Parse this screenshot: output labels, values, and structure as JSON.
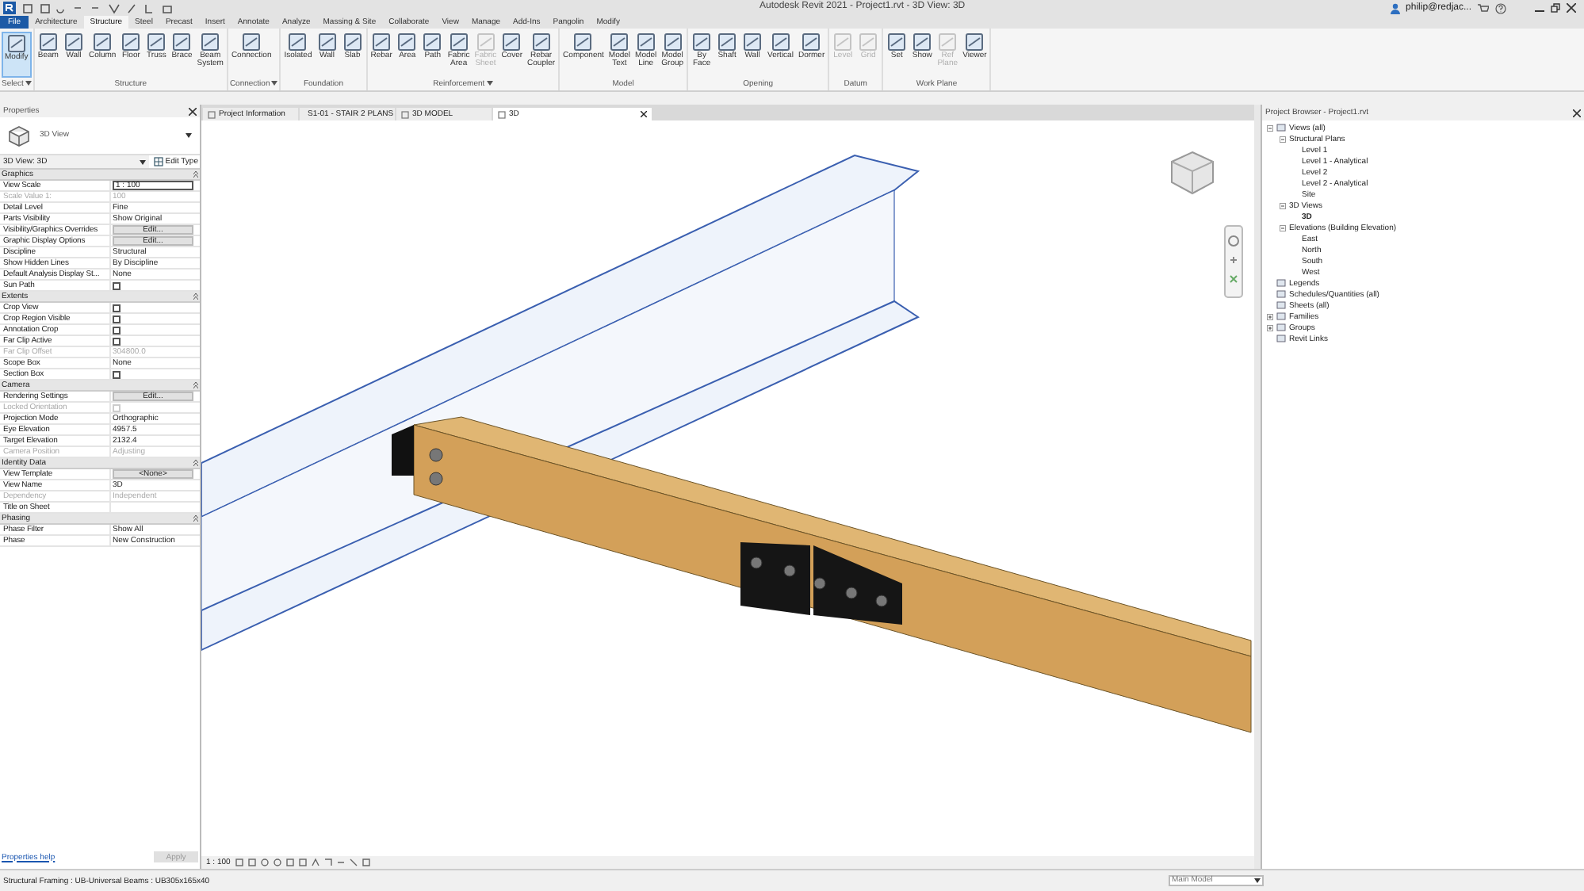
{
  "window": {
    "title": "Autodesk Revit 2021 - Project1.rvt - 3D View: 3D",
    "user": "philip@redjac..."
  },
  "menu_tabs": [
    {
      "label": "File",
      "kind": "application",
      "selected": false
    },
    {
      "label": "Architecture",
      "kind": "tab",
      "selected": false
    },
    {
      "label": "Structure",
      "kind": "tab",
      "selected": true
    },
    {
      "label": "Steel",
      "kind": "tab",
      "selected": false
    },
    {
      "label": "Precast",
      "kind": "tab",
      "selected": false
    },
    {
      "label": "Insert",
      "kind": "tab",
      "selected": false
    },
    {
      "label": "Annotate",
      "kind": "tab",
      "selected": false
    },
    {
      "label": "Analyze",
      "kind": "tab",
      "selected": false
    },
    {
      "label": "Massing & Site",
      "kind": "tab",
      "selected": false
    },
    {
      "label": "Collaborate",
      "kind": "tab",
      "selected": false
    },
    {
      "label": "View",
      "kind": "tab",
      "selected": false
    },
    {
      "label": "Manage",
      "kind": "tab",
      "selected": false
    },
    {
      "label": "Add-Ins",
      "kind": "tab",
      "selected": false
    },
    {
      "label": "Pangolin",
      "kind": "tab",
      "selected": false
    },
    {
      "label": "Modify",
      "kind": "tab",
      "selected": false
    }
  ],
  "ribbon_panels": [
    {
      "title": "Select",
      "dropdown": true,
      "tools": [
        {
          "label": "Modify",
          "selected": true,
          "disabled": false
        }
      ]
    },
    {
      "title": "Structure",
      "dropdown": false,
      "tools": [
        {
          "label": "Beam",
          "selected": false,
          "disabled": false
        },
        {
          "label": "Wall",
          "selected": false,
          "disabled": false
        },
        {
          "label": "Column",
          "selected": false,
          "disabled": false
        },
        {
          "label": "Floor",
          "selected": false,
          "disabled": false
        },
        {
          "label": "Truss",
          "selected": false,
          "disabled": false
        },
        {
          "label": "Brace",
          "selected": false,
          "disabled": false
        },
        {
          "label": "Beam System",
          "selected": false,
          "disabled": false
        }
      ]
    },
    {
      "title": "Connection",
      "dropdown": true,
      "tools": [
        {
          "label": "Connection",
          "selected": false,
          "disabled": false
        }
      ]
    },
    {
      "title": "Foundation",
      "dropdown": false,
      "tools": [
        {
          "label": "Isolated",
          "selected": false,
          "disabled": false
        },
        {
          "label": "Wall",
          "selected": false,
          "disabled": false
        },
        {
          "label": "Slab",
          "selected": false,
          "disabled": false
        }
      ]
    },
    {
      "title": "Reinforcement",
      "dropdown": true,
      "tools": [
        {
          "label": "Rebar",
          "selected": false,
          "disabled": false
        },
        {
          "label": "Area",
          "selected": false,
          "disabled": false
        },
        {
          "label": "Path",
          "selected": false,
          "disabled": false
        },
        {
          "label": "Fabric Area",
          "selected": false,
          "disabled": false
        },
        {
          "label": "Fabric Sheet",
          "selected": false,
          "disabled": true
        },
        {
          "label": "Cover",
          "selected": false,
          "disabled": false
        },
        {
          "label": "Rebar Coupler",
          "selected": false,
          "disabled": false
        }
      ]
    },
    {
      "title": "Model",
      "dropdown": false,
      "tools": [
        {
          "label": "Component",
          "selected": false,
          "disabled": false
        },
        {
          "label": "Model Text",
          "selected": false,
          "disabled": false
        },
        {
          "label": "Model Line",
          "selected": false,
          "disabled": false
        },
        {
          "label": "Model Group",
          "selected": false,
          "disabled": false
        }
      ]
    },
    {
      "title": "Opening",
      "dropdown": false,
      "tools": [
        {
          "label": "By Face",
          "selected": false,
          "disabled": false
        },
        {
          "label": "Shaft",
          "selected": false,
          "disabled": false
        },
        {
          "label": "Wall",
          "selected": false,
          "disabled": false
        },
        {
          "label": "Vertical",
          "selected": false,
          "disabled": false
        },
        {
          "label": "Dormer",
          "selected": false,
          "disabled": false
        }
      ]
    },
    {
      "title": "Datum",
      "dropdown": false,
      "tools": [
        {
          "label": "Level",
          "selected": false,
          "disabled": true
        },
        {
          "label": "Grid",
          "selected": false,
          "disabled": true
        }
      ]
    },
    {
      "title": "Work Plane",
      "dropdown": false,
      "tools": [
        {
          "label": "Set",
          "selected": false,
          "disabled": false
        },
        {
          "label": "Show",
          "selected": false,
          "disabled": false
        },
        {
          "label": "Ref Plane",
          "selected": false,
          "disabled": true
        },
        {
          "label": "Viewer",
          "selected": false,
          "disabled": false
        }
      ]
    }
  ],
  "properties": {
    "title": "Properties",
    "type_name": "3D View",
    "type_selector": "3D View: 3D",
    "edit_type": "Edit Type",
    "groups": [
      {
        "name": "Graphics",
        "rows": [
          {
            "label": "View Scale",
            "value": "1 : 100",
            "kind": "field",
            "disabled": false
          },
          {
            "label": "Scale Value    1:",
            "value": "100",
            "kind": "text",
            "disabled": true
          },
          {
            "label": "Detail Level",
            "value": "Fine",
            "kind": "text",
            "disabled": false
          },
          {
            "label": "Parts Visibility",
            "value": "Show Original",
            "kind": "text",
            "disabled": false
          },
          {
            "label": "Visibility/Graphics Overrides",
            "value": "Edit...",
            "kind": "button",
            "disabled": false
          },
          {
            "label": "Graphic Display Options",
            "value": "Edit...",
            "kind": "button",
            "disabled": false
          },
          {
            "label": "Discipline",
            "value": "Structural",
            "kind": "text",
            "disabled": false
          },
          {
            "label": "Show Hidden Lines",
            "value": "By Discipline",
            "kind": "text",
            "disabled": false
          },
          {
            "label": "Default Analysis Display St...",
            "value": "None",
            "kind": "text",
            "disabled": false
          },
          {
            "label": "Sun Path",
            "kind": "checkbox",
            "checked": false,
            "disabled": false
          }
        ]
      },
      {
        "name": "Extents",
        "rows": [
          {
            "label": "Crop View",
            "kind": "checkbox",
            "checked": false,
            "disabled": false
          },
          {
            "label": "Crop Region Visible",
            "kind": "checkbox",
            "checked": false,
            "disabled": false
          },
          {
            "label": "Annotation Crop",
            "kind": "checkbox",
            "checked": false,
            "disabled": false
          },
          {
            "label": "Far Clip Active",
            "kind": "checkbox",
            "checked": false,
            "disabled": false
          },
          {
            "label": "Far Clip Offset",
            "value": "304800.0",
            "kind": "text",
            "disabled": true
          },
          {
            "label": "Scope Box",
            "value": "None",
            "kind": "text",
            "disabled": false
          },
          {
            "label": "Section Box",
            "kind": "checkbox",
            "checked": false,
            "disabled": false
          }
        ]
      },
      {
        "name": "Camera",
        "rows": [
          {
            "label": "Rendering Settings",
            "value": "Edit...",
            "kind": "button",
            "disabled": false
          },
          {
            "label": "Locked Orientation",
            "kind": "checkbox",
            "checked": false,
            "disabled": true
          },
          {
            "label": "Projection Mode",
            "value": "Orthographic",
            "kind": "text",
            "disabled": false
          },
          {
            "label": "Eye Elevation",
            "value": "4957.5",
            "kind": "text",
            "disabled": false
          },
          {
            "label": "Target Elevation",
            "value": "2132.4",
            "kind": "text",
            "disabled": false
          },
          {
            "label": "Camera Position",
            "value": "Adjusting",
            "kind": "text",
            "disabled": true
          }
        ]
      },
      {
        "name": "Identity Data",
        "rows": [
          {
            "label": "View Template",
            "value": "<None>",
            "kind": "button",
            "disabled": false
          },
          {
            "label": "View Name",
            "value": "3D",
            "kind": "text",
            "disabled": false
          },
          {
            "label": "Dependency",
            "value": "Independent",
            "kind": "text",
            "disabled": true
          },
          {
            "label": "Title on Sheet",
            "kind": "text",
            "disabled": false
          }
        ]
      },
      {
        "name": "Phasing",
        "rows": [
          {
            "label": "Phase Filter",
            "value": "Show All",
            "kind": "text",
            "disabled": false
          },
          {
            "label": "Phase",
            "value": "New Construction",
            "kind": "text",
            "disabled": false
          }
        ]
      }
    ],
    "help_link": "Properties help",
    "apply": "Apply"
  },
  "view_tabs": [
    {
      "label": "Project Information",
      "selected": false
    },
    {
      "label": "S1-01 - STAIR 2 PLANS",
      "selected": false
    },
    {
      "label": "3D MODEL",
      "selected": false
    },
    {
      "label": "3D",
      "selected": true
    }
  ],
  "view_control_bar": {
    "scale": "1 : 100"
  },
  "project_browser": {
    "title": "Project Browser - Project1.rvt",
    "tree": [
      {
        "label": "Views (all)",
        "expanded": true,
        "bold": false,
        "children": [
          {
            "label": "Structural Plans",
            "expanded": true,
            "bold": false,
            "children": [
              {
                "label": "Level 1",
                "bold": false
              },
              {
                "label": "Level 1 - Analytical",
                "bold": false
              },
              {
                "label": "Level 2",
                "bold": false
              },
              {
                "label": "Level 2 - Analytical",
                "bold": false
              },
              {
                "label": "Site",
                "bold": false
              }
            ]
          },
          {
            "label": "3D Views",
            "expanded": true,
            "bold": false,
            "children": [
              {
                "label": "3D",
                "bold": true
              }
            ]
          },
          {
            "label": "Elevations (Building Elevation)",
            "expanded": true,
            "bold": false,
            "children": [
              {
                "label": "East",
                "bold": false
              },
              {
                "label": "North",
                "bold": false
              },
              {
                "label": "South",
                "bold": false
              },
              {
                "label": "West",
                "bold": false
              }
            ]
          }
        ]
      },
      {
        "label": "Legends",
        "bold": false
      },
      {
        "label": "Schedules/Quantities (all)",
        "bold": false
      },
      {
        "label": "Sheets (all)",
        "bold": false
      },
      {
        "label": "Families",
        "expanded": false,
        "bold": false
      },
      {
        "label": "Groups",
        "expanded": false,
        "bold": false
      },
      {
        "label": "Revit Links",
        "bold": false
      }
    ]
  },
  "status_bar": {
    "text": "Structural Framing : UB-Universal Beams : UB305x165x40",
    "model": "Main Model"
  }
}
